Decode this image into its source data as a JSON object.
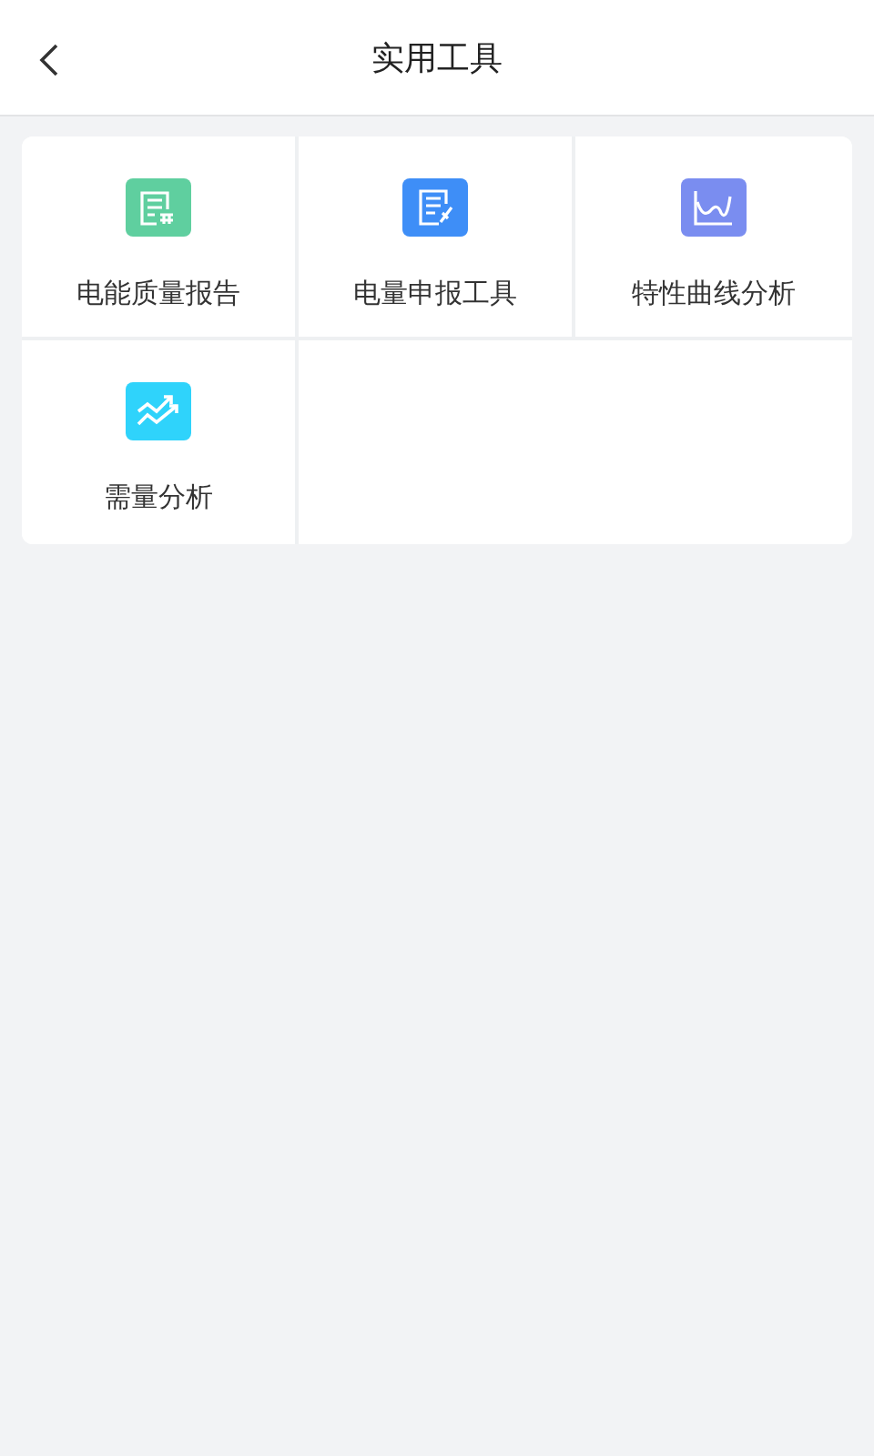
{
  "header": {
    "title": "实用工具"
  },
  "tools": [
    {
      "label": "电能质量报告",
      "kind": "report",
      "color": "#5fcf9f"
    },
    {
      "label": "电量申报工具",
      "kind": "edit",
      "color": "#3e8ef7"
    },
    {
      "label": "特性曲线分析",
      "kind": "curve",
      "color": "#7a8df0"
    },
    {
      "label": "需量分析",
      "kind": "trend",
      "color": "#2fd3fb"
    }
  ]
}
